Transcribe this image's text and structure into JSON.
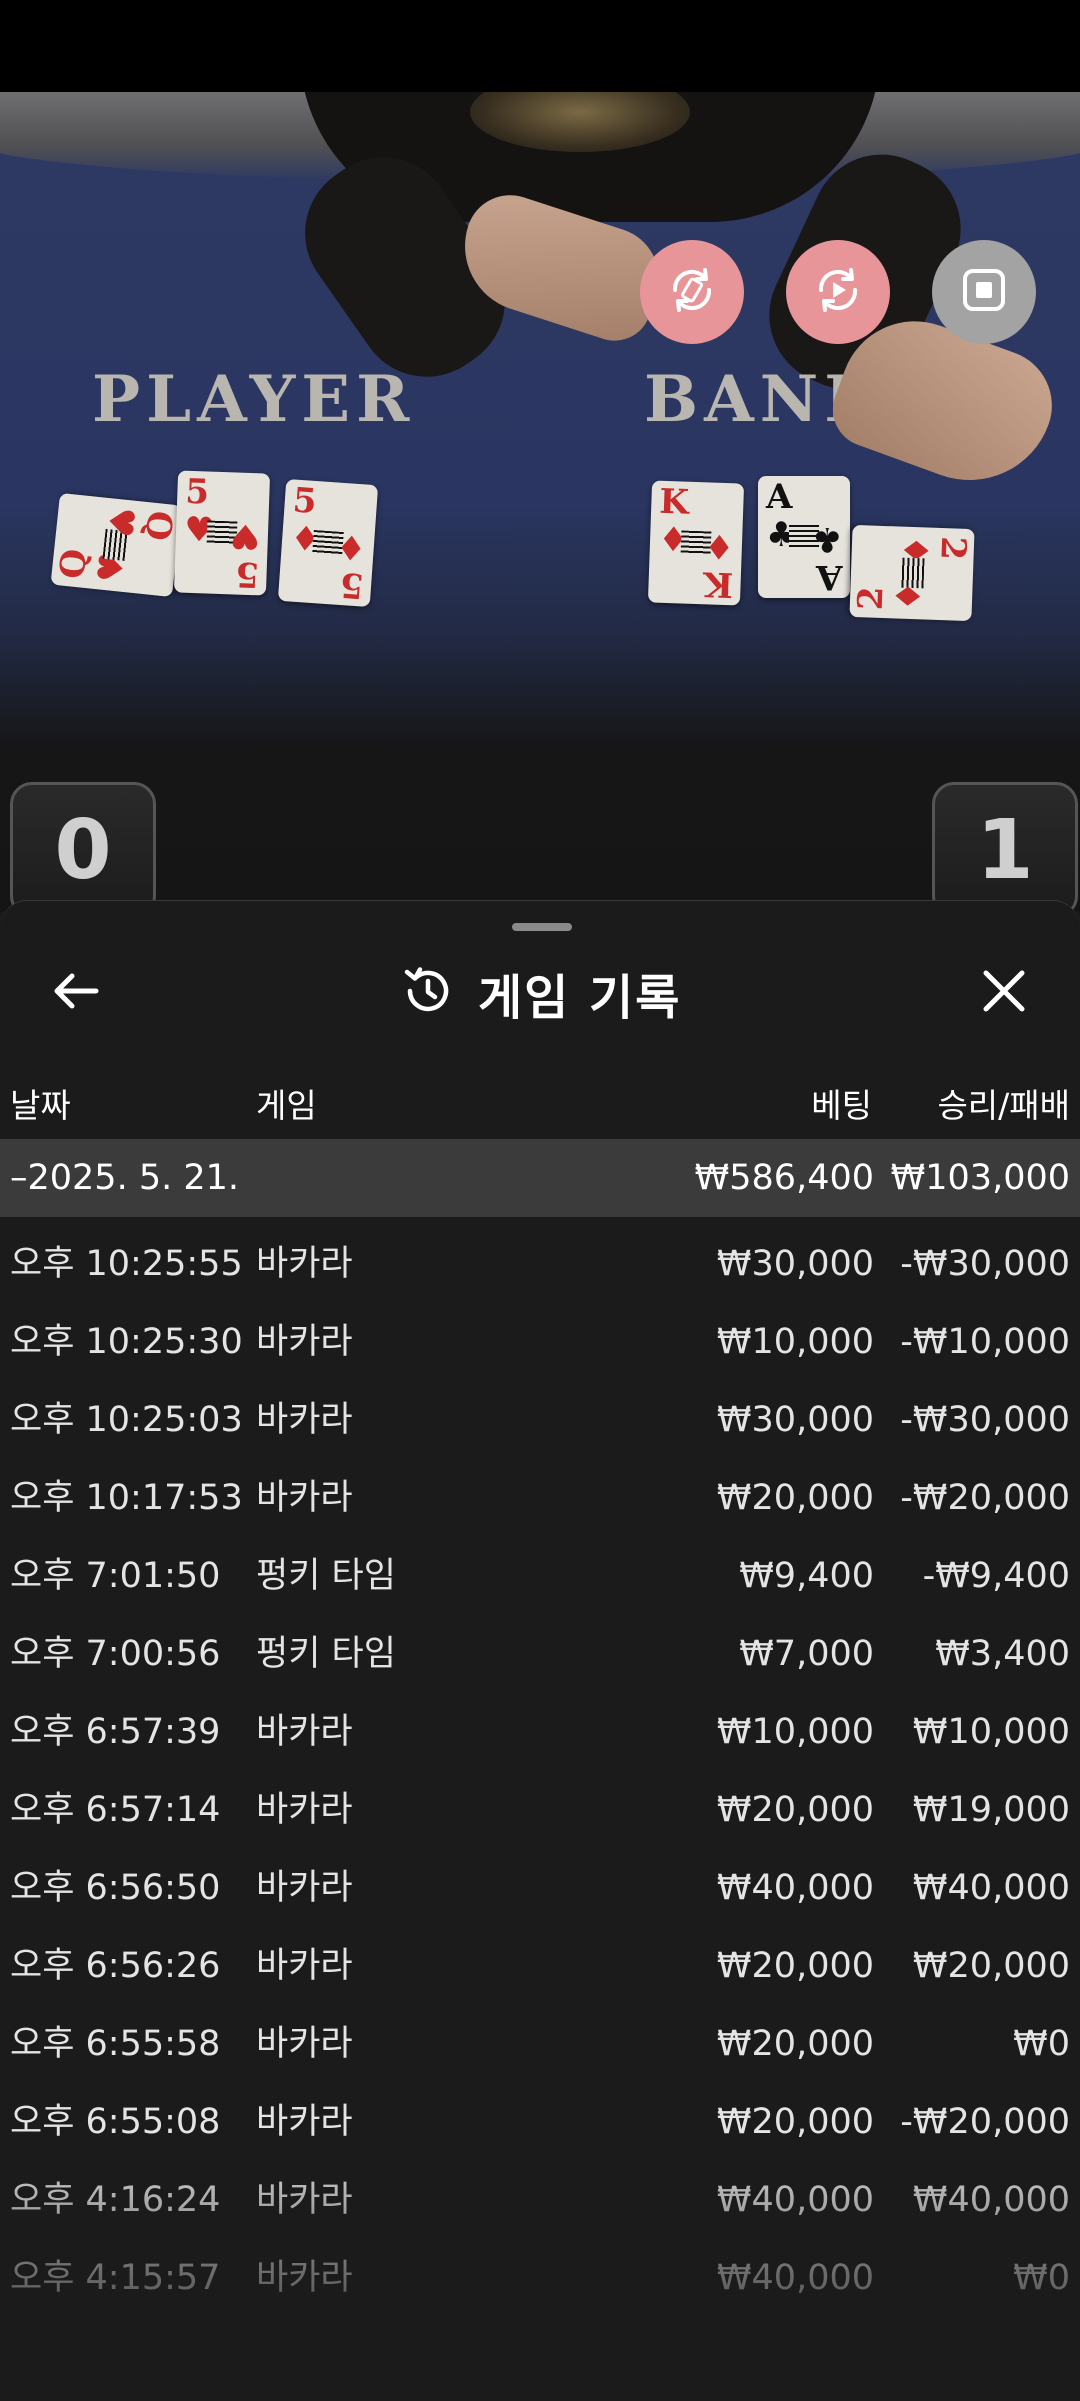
{
  "video": {
    "player_label": "PLAYER",
    "banker_label": "BANKER",
    "player_cards": [
      {
        "rank": "Q",
        "suit": "♥",
        "color": "red"
      },
      {
        "rank": "5",
        "suit": "♥",
        "color": "red"
      },
      {
        "rank": "5",
        "suit": "♦",
        "color": "red"
      }
    ],
    "banker_cards": [
      {
        "rank": "K",
        "suit": "♦",
        "color": "red"
      },
      {
        "rank": "A",
        "suit": "♣",
        "color": "black"
      },
      {
        "rank": "2",
        "suit": "♦",
        "color": "red"
      }
    ],
    "player_score": "0",
    "banker_score": "1",
    "controls": [
      {
        "name": "rotate-screen-icon",
        "color": "#e8959a"
      },
      {
        "name": "replay-icon",
        "color": "#e8959a"
      },
      {
        "name": "stop-icon",
        "color": "#a3a3a3"
      }
    ]
  },
  "history": {
    "title": "게임 기록",
    "columns": {
      "date": "날짜",
      "game": "게임",
      "bet": "베팅",
      "result": "승리/패배"
    },
    "group": {
      "date": "–2025. 5. 21.",
      "bet": "₩586,400",
      "result": "₩103,000"
    },
    "rows": [
      {
        "time": "오후 10:25:55",
        "game": "바카라",
        "bet": "₩30,000",
        "result": "-₩30,000"
      },
      {
        "time": "오후 10:25:30",
        "game": "바카라",
        "bet": "₩10,000",
        "result": "-₩10,000"
      },
      {
        "time": "오후 10:25:03",
        "game": "바카라",
        "bet": "₩30,000",
        "result": "-₩30,000"
      },
      {
        "time": "오후 10:17:53",
        "game": "바카라",
        "bet": "₩20,000",
        "result": "-₩20,000"
      },
      {
        "time": "오후 7:01:50",
        "game": "펑키 타임",
        "bet": "₩9,400",
        "result": "-₩9,400"
      },
      {
        "time": "오후 7:00:56",
        "game": "펑키 타임",
        "bet": "₩7,000",
        "result": "₩3,400"
      },
      {
        "time": "오후 6:57:39",
        "game": "바카라",
        "bet": "₩10,000",
        "result": "₩10,000"
      },
      {
        "time": "오후 6:57:14",
        "game": "바카라",
        "bet": "₩20,000",
        "result": "₩19,000"
      },
      {
        "time": "오후 6:56:50",
        "game": "바카라",
        "bet": "₩40,000",
        "result": "₩40,000"
      },
      {
        "time": "오후 6:56:26",
        "game": "바카라",
        "bet": "₩20,000",
        "result": "₩20,000"
      },
      {
        "time": "오후 6:55:58",
        "game": "바카라",
        "bet": "₩20,000",
        "result": "₩0"
      },
      {
        "time": "오후 6:55:08",
        "game": "바카라",
        "bet": "₩20,000",
        "result": "-₩20,000"
      },
      {
        "time": "오후 4:16:24",
        "game": "바카라",
        "bet": "₩40,000",
        "result": "₩40,000"
      },
      {
        "time": "오후 4:15:57",
        "game": "바카라",
        "bet": "₩40,000",
        "result": "₩0"
      }
    ]
  }
}
